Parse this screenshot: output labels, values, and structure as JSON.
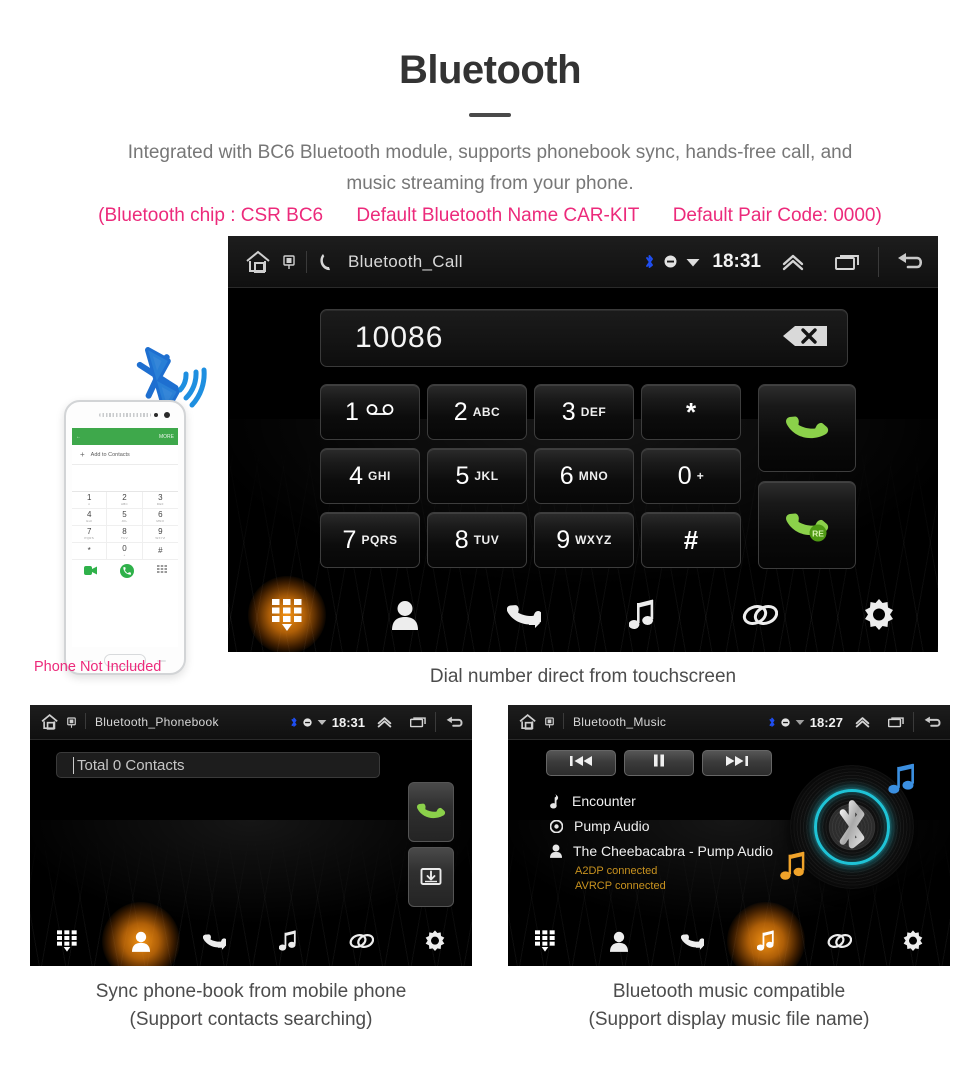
{
  "header": {
    "title": "Bluetooth",
    "intro_line1": "Integrated with BC6 Bluetooth module, supports phonebook sync, hands-free call, and",
    "intro_line2": "music streaming from your phone.",
    "spec_open": "(Bluetooth chip : CSR BC6",
    "spec_name": "Default Bluetooth Name CAR-KIT",
    "spec_code": "Default Pair Code: 0000)",
    "accent_pink": "#ec2a7b"
  },
  "call_screen": {
    "statusbar": {
      "title": "Bluetooth_Call",
      "clock": "18:31",
      "home_icon": "home-icon",
      "sim_icon": "sim-card-icon",
      "phone_icon": "phone-handset-icon",
      "bluetooth_icon": "bluetooth-icon",
      "mute_icon": "mute-icon",
      "wifi_icon": "wifi-icon",
      "expand_icon": "chevron-up-icon",
      "recents_icon": "recents-icon",
      "back_icon": "back-arrow-icon"
    },
    "dial_value": "10086",
    "backspace_icon": "backspace-icon",
    "keys": [
      {
        "digit": "1",
        "letters": "",
        "glyph": "voicemail-dots"
      },
      {
        "digit": "2",
        "letters": "ABC",
        "glyph": ""
      },
      {
        "digit": "3",
        "letters": "DEF",
        "glyph": ""
      },
      {
        "digit": "*",
        "letters": "",
        "glyph": ""
      },
      {
        "digit": "4",
        "letters": "GHI",
        "glyph": ""
      },
      {
        "digit": "5",
        "letters": "JKL",
        "glyph": ""
      },
      {
        "digit": "6",
        "letters": "MNO",
        "glyph": ""
      },
      {
        "digit": "0",
        "letters": "+",
        "glyph": ""
      },
      {
        "digit": "7",
        "letters": "PQRS",
        "glyph": ""
      },
      {
        "digit": "8",
        "letters": "TUV",
        "glyph": ""
      },
      {
        "digit": "9",
        "letters": "WXYZ",
        "glyph": ""
      },
      {
        "digit": "#",
        "letters": "",
        "glyph": ""
      }
    ],
    "call_button_icon": "green-call-icon",
    "redial_button_icon": "green-redial-icon",
    "redial_badge": "RE",
    "nav": [
      {
        "name": "dialpad",
        "icon": "dialpad-icon",
        "active": true
      },
      {
        "name": "contacts",
        "icon": "person-icon",
        "active": false
      },
      {
        "name": "call-log",
        "icon": "call-log-icon",
        "active": false
      },
      {
        "name": "music",
        "icon": "music-note-icon",
        "active": false
      },
      {
        "name": "pair",
        "icon": "link-icon",
        "active": false
      },
      {
        "name": "settings",
        "icon": "gear-icon",
        "active": false
      }
    ],
    "caption": "Dial number direct from touchscreen"
  },
  "phone_mock": {
    "appbar_back": "back-arrow-icon",
    "appbar_more": "MORE",
    "add_contact_label": "Add to Contacts",
    "keys": [
      {
        "d": "1",
        "s": "∞"
      },
      {
        "d": "2",
        "s": "ABC"
      },
      {
        "d": "3",
        "s": "DEF"
      },
      {
        "d": "4",
        "s": "GHI"
      },
      {
        "d": "5",
        "s": "JKL"
      },
      {
        "d": "6",
        "s": "MNO"
      },
      {
        "d": "7",
        "s": "PQRS"
      },
      {
        "d": "8",
        "s": "TUV"
      },
      {
        "d": "9",
        "s": "WXYZ"
      },
      {
        "d": "*",
        "s": ""
      },
      {
        "d": "0",
        "s": "+"
      },
      {
        "d": "#",
        "s": ""
      }
    ],
    "video_icon": "video-call-icon",
    "call_icon": "phone-call-icon",
    "keypad_icon": "keypad-icon",
    "note": "Phone Not Included",
    "bluetooth_badge_icon": "bluetooth-wireless-icon"
  },
  "phonebook_screen": {
    "statusbar": {
      "title": "Bluetooth_Phonebook",
      "clock": "18:31"
    },
    "search_value": "Total 0 Contacts",
    "call_button_icon": "green-call-icon",
    "download_button_icon": "download-contacts-icon",
    "nav": [
      {
        "name": "dialpad",
        "icon": "dialpad-icon",
        "active": false
      },
      {
        "name": "contacts",
        "icon": "person-icon",
        "active": true
      },
      {
        "name": "call-log",
        "icon": "call-log-icon",
        "active": false
      },
      {
        "name": "music",
        "icon": "music-note-icon",
        "active": false
      },
      {
        "name": "pair",
        "icon": "link-icon",
        "active": false
      },
      {
        "name": "settings",
        "icon": "gear-icon",
        "active": false
      }
    ],
    "caption_line1": "Sync phone-book from mobile phone",
    "caption_line2": "(Support contacts searching)"
  },
  "music_screen": {
    "statusbar": {
      "title": "Bluetooth_Music",
      "clock": "18:27"
    },
    "controls": [
      {
        "name": "previous",
        "icon": "skip-previous-icon"
      },
      {
        "name": "pause",
        "icon": "pause-icon"
      },
      {
        "name": "next",
        "icon": "skip-next-icon"
      }
    ],
    "track_title": "Encounter",
    "album": "Pump Audio",
    "artist": "The Cheebacabra - Pump Audio",
    "status_a2dp": "A2DP connected",
    "status_avrcp": "AVRCP connected",
    "status_color": "#c8921f",
    "vinyl_icon": "bluetooth-vinyl-icon",
    "ring_color": "#1fc3d6",
    "nav": [
      {
        "name": "dialpad",
        "icon": "dialpad-icon",
        "active": false
      },
      {
        "name": "contacts",
        "icon": "person-icon",
        "active": false
      },
      {
        "name": "call-log",
        "icon": "call-log-icon",
        "active": false
      },
      {
        "name": "music",
        "icon": "music-note-icon",
        "active": true
      },
      {
        "name": "pair",
        "icon": "link-icon",
        "active": false
      },
      {
        "name": "settings",
        "icon": "gear-icon",
        "active": false
      }
    ],
    "caption_line1": "Bluetooth music compatible",
    "caption_line2": "(Support display music file name)"
  }
}
